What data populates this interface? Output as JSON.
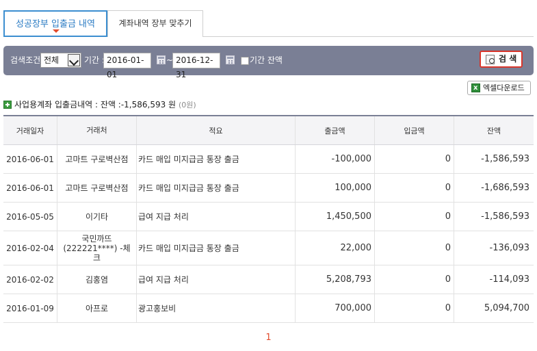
{
  "tabs": [
    {
      "label": "성공장부 입출금 내역",
      "active": true
    },
    {
      "label": "계좌내역 장부 맞추기",
      "active": false
    }
  ],
  "search": {
    "condition_label": "검색조건 :",
    "condition_value": "전체",
    "period_label": "기간 :",
    "date_from": "2016-01-01",
    "date_separator": "~",
    "date_to": "2016-12-31",
    "period_balance_label": "기간 잔액",
    "search_button": "검 색"
  },
  "excel_button": "엑셀다운로드",
  "section": {
    "title": "사업용계좌 입출금내역",
    "balance_label": ": 잔액 :",
    "balance_value": "-1,586,593 원",
    "balance_note": "(0원)"
  },
  "table": {
    "columns": [
      "거래일자",
      "거래처",
      "적요",
      "출금액",
      "입금액",
      "잔액"
    ],
    "rows": [
      {
        "date": "2016-06-01",
        "partner": "고마트 구로벽산점",
        "memo": "카드 매입 미지급금 통장 출금",
        "withdraw": "-100,000",
        "deposit": "0",
        "balance": "-1,586,593"
      },
      {
        "date": "2016-06-01",
        "partner": "고마트 구로벽산점",
        "memo": "카드 매입 미지급금 통장 출금",
        "withdraw": "100,000",
        "deposit": "0",
        "balance": "-1,686,593"
      },
      {
        "date": "2016-05-05",
        "partner": "이기타",
        "memo": "급여 지급 처리",
        "withdraw": "1,450,500",
        "deposit": "0",
        "balance": "-1,586,593"
      },
      {
        "date": "2016-02-04",
        "partner": "국민까뜨(222221****) -체크",
        "memo": "카드 매입 미지급금 통장 출금",
        "withdraw": "22,000",
        "deposit": "0",
        "balance": "-136,093"
      },
      {
        "date": "2016-02-02",
        "partner": "김홍염",
        "memo": "급여 지급 처리",
        "withdraw": "5,208,793",
        "deposit": "0",
        "balance": "-114,093"
      },
      {
        "date": "2016-01-09",
        "partner": "아프로",
        "memo": "광고홍보비",
        "withdraw": "700,000",
        "deposit": "0",
        "balance": "5,094,700"
      }
    ]
  },
  "pagination": {
    "current": "1"
  }
}
